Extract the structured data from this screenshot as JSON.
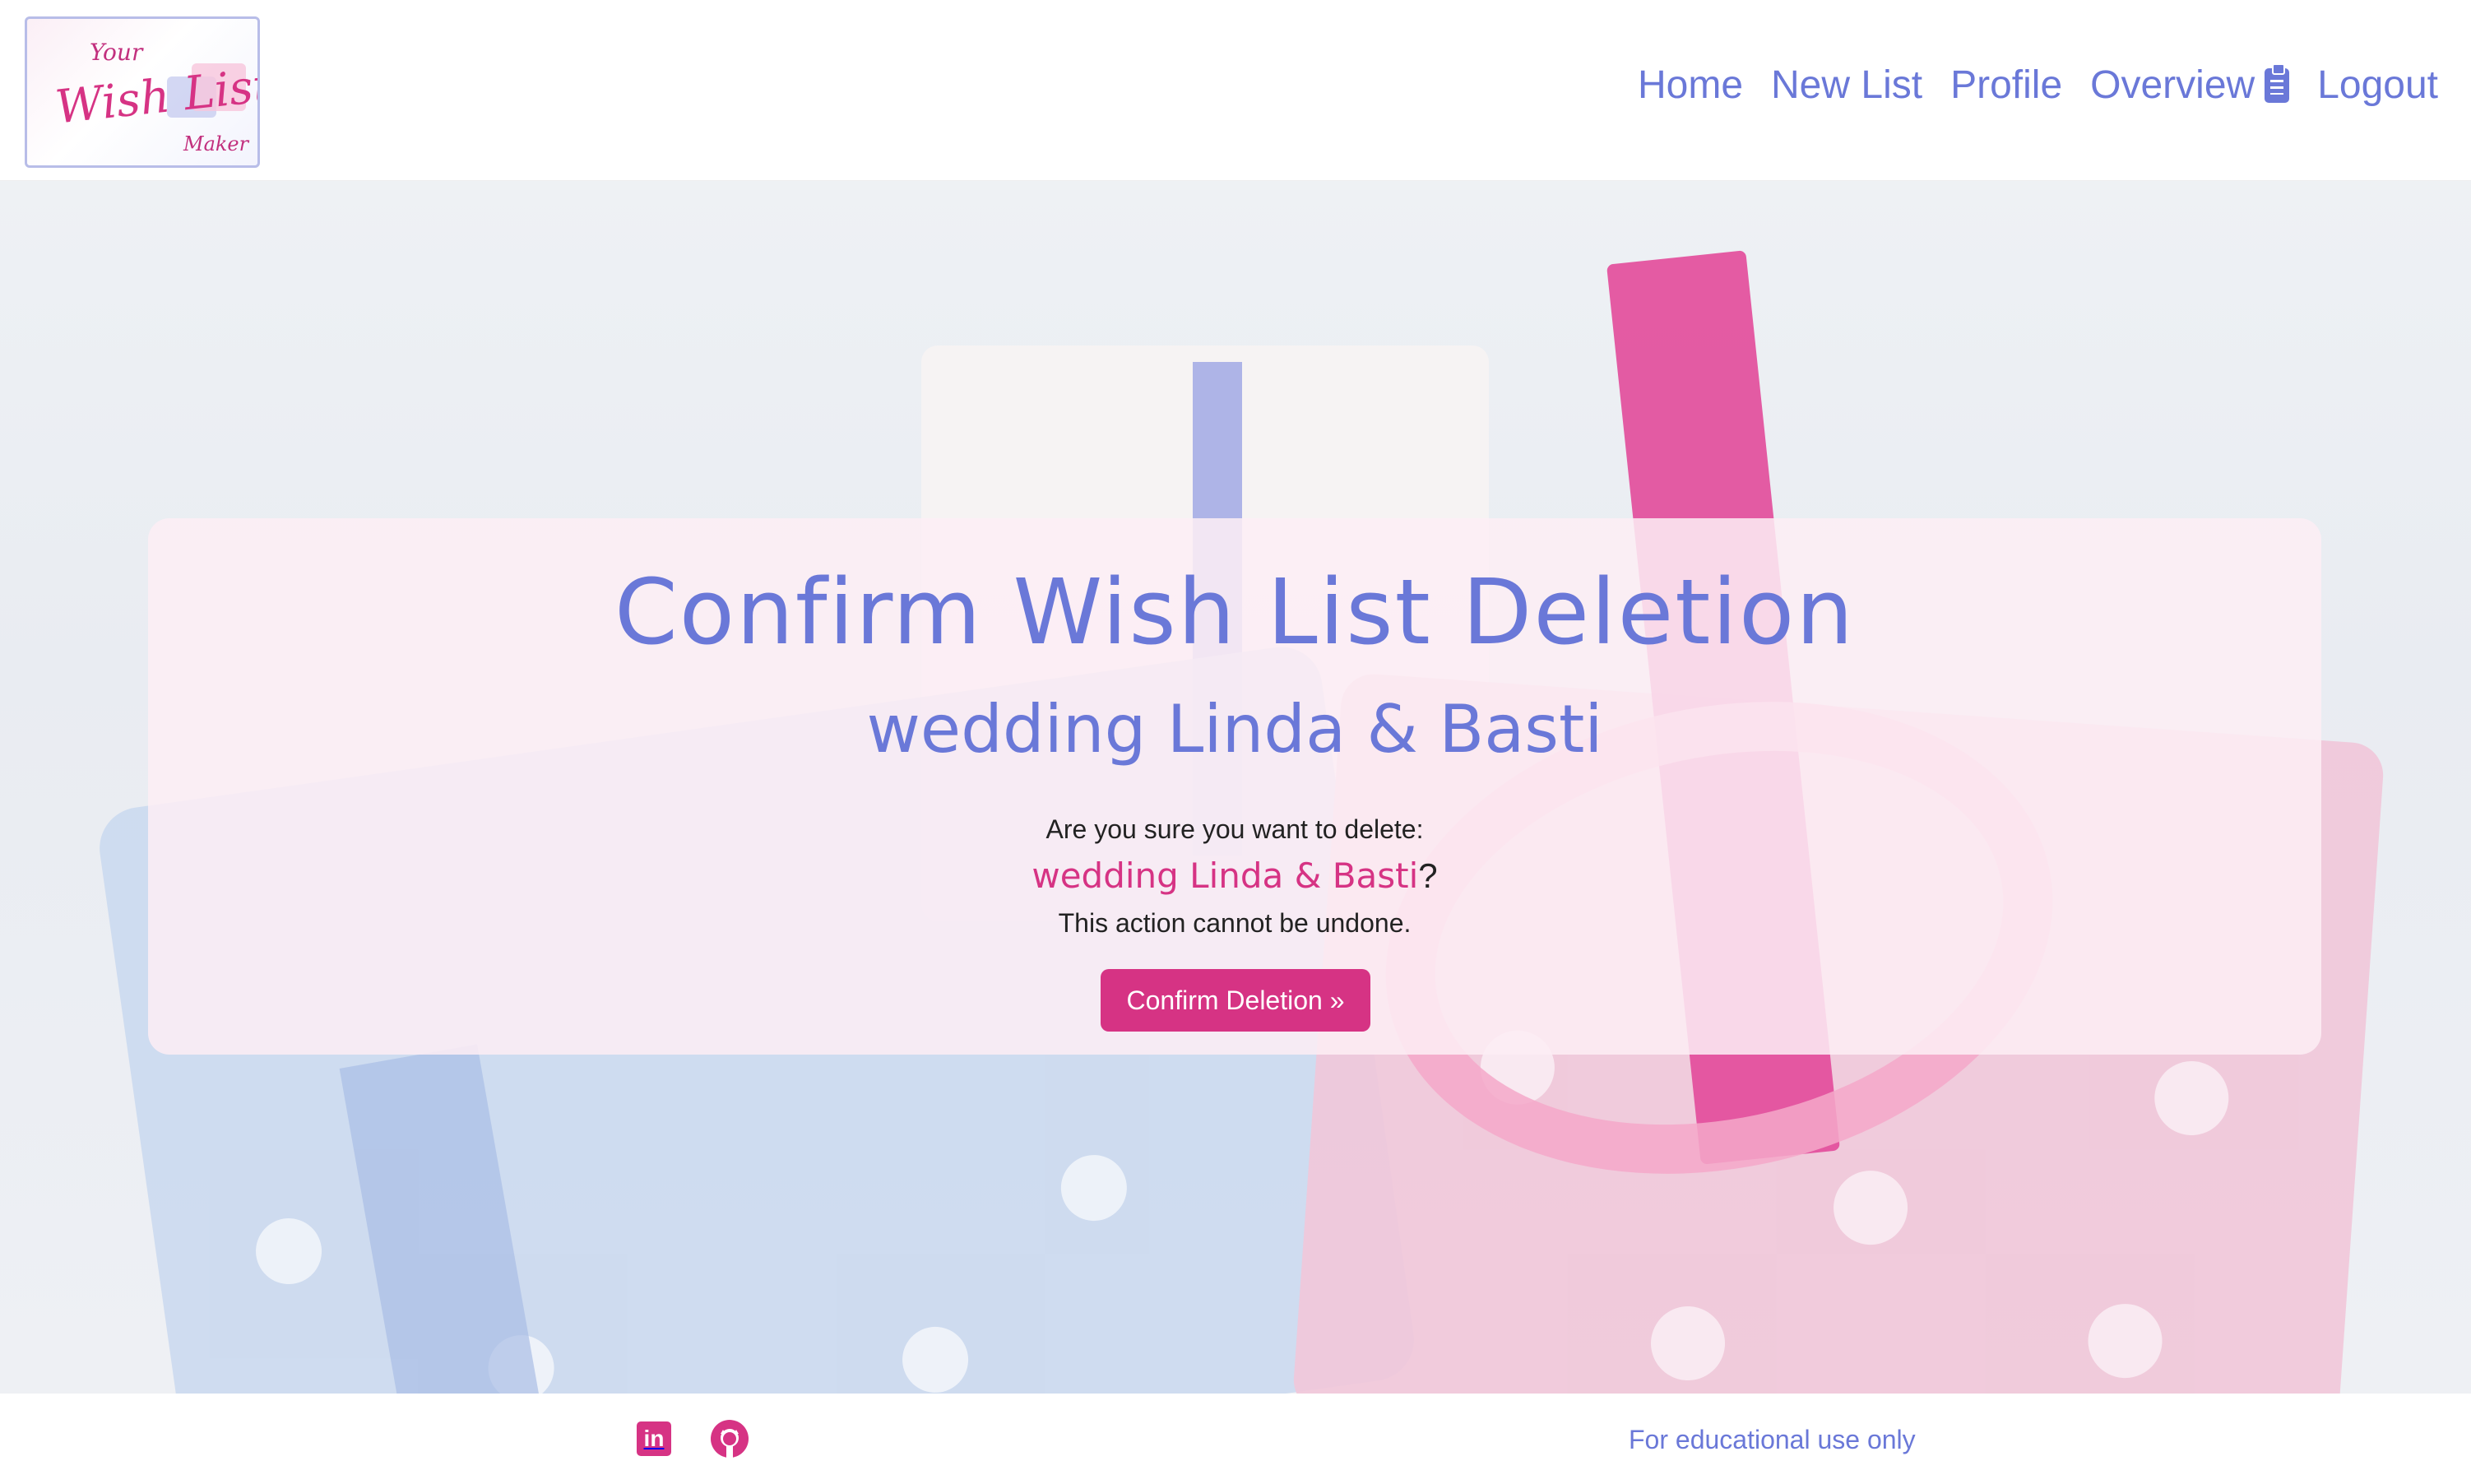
{
  "brand": {
    "logo_small_text": "Your",
    "logo_main_text": "Wish List",
    "logo_maker_text": "Maker"
  },
  "nav": {
    "items": [
      {
        "label": "Home"
      },
      {
        "label": "New List"
      },
      {
        "label": "Profile"
      },
      {
        "label": "Overview"
      },
      {
        "label": "Logout"
      }
    ],
    "overview_icon": "clipboard-list-icon"
  },
  "panel": {
    "title": "Confirm Wish List Deletion",
    "subtitle": "wedding Linda & Basti",
    "question": "Are you sure you want to delete:",
    "list_name": "wedding Linda & Basti",
    "question_mark": "?",
    "warning": "This action cannot be undone.",
    "confirm_label": "Confirm Deletion »"
  },
  "footer": {
    "social": [
      "linkedin-icon",
      "github-icon"
    ],
    "linkedin_glyph": "in",
    "note": "For educational use only"
  },
  "colors": {
    "accent_blue": "#6a78d8",
    "accent_pink": "#d63384"
  }
}
